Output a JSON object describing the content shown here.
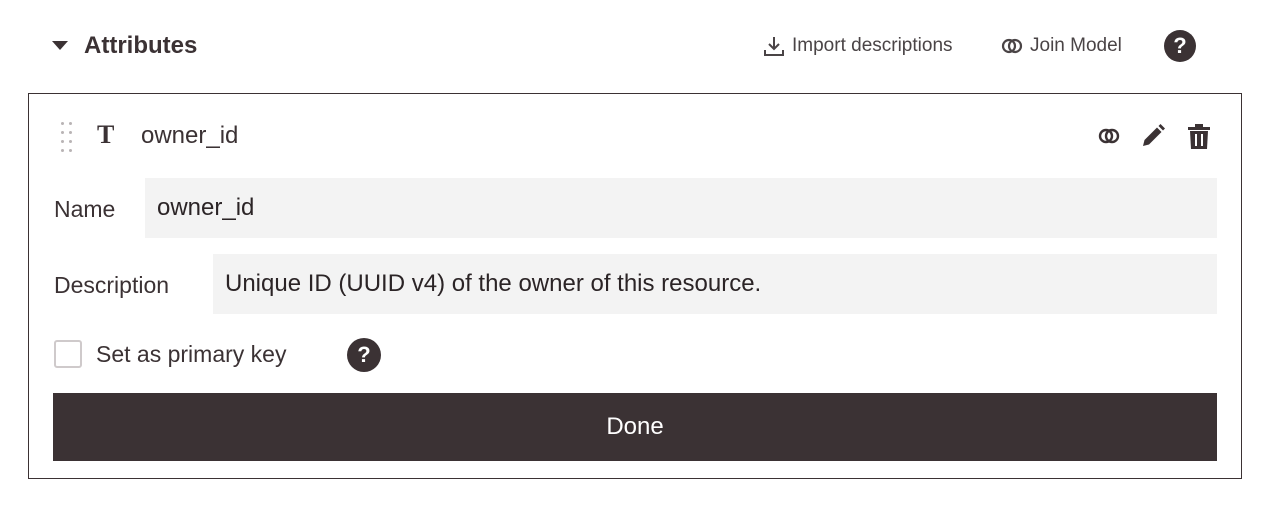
{
  "section": {
    "title": "Attributes",
    "import_label": "Import descriptions",
    "join_label": "Join Model",
    "help_glyph": "?"
  },
  "attribute": {
    "type_glyph": "T",
    "name": "owner_id",
    "name_label": "Name",
    "name_value": "owner_id",
    "description_label": "Description",
    "description_value": "Unique ID (UUID v4) of the owner of this resource.",
    "primary_key_label": "Set as primary key",
    "primary_key_checked": false,
    "help_glyph": "?",
    "done_label": "Done"
  },
  "icons": {
    "collapse": "caret-down-icon",
    "import": "download-icon",
    "join": "join-icon",
    "help": "help-icon",
    "drag": "drag-handle-icon",
    "type": "text-type-icon",
    "edit": "pencil-icon",
    "delete": "trash-icon"
  },
  "colors": {
    "primary": "#3b3234",
    "input_bg": "#f3f3f3",
    "checkbox_border": "#cfcacb"
  }
}
